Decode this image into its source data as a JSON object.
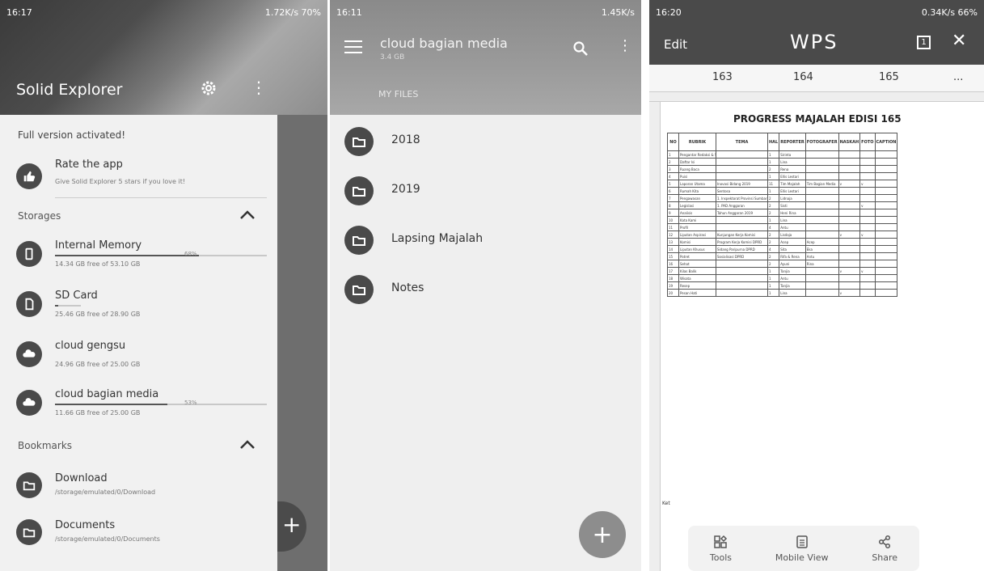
{
  "panel1": {
    "status": {
      "time": "16:17",
      "right": "1.72K/s 70%"
    },
    "app_title": "Solid Explorer",
    "drawer": {
      "full_version": "Full version activated!",
      "rate": {
        "title": "Rate the app",
        "subtitle": "Give Solid Explorer 5 stars if you love it!"
      },
      "storages_label": "Storages",
      "storages": [
        {
          "name": "Internal Memory",
          "detail": "14.34 GB free of 53.10 GB",
          "pct": "68%",
          "fill": 0.68
        },
        {
          "name": "SD Card",
          "detail": "25.46 GB free of 28.90 GB",
          "pct": "",
          "fill": 0.12
        },
        {
          "name": "cloud gengsu",
          "detail": "24.96 GB free of 25.00 GB",
          "pct": "",
          "fill": 0.01
        },
        {
          "name": "cloud bagian media",
          "detail": "11.66 GB free of 25.00 GB",
          "pct": "53%",
          "fill": 0.53
        }
      ],
      "bookmarks_label": "Bookmarks",
      "bookmarks": [
        {
          "name": "Download",
          "path": "/storage/emulated/0/Download"
        },
        {
          "name": "Documents",
          "path": "/storage/emulated/0/Documents"
        }
      ]
    }
  },
  "panel2": {
    "status": {
      "time": "16:11",
      "right": "1.45K/s"
    },
    "title": "cloud bagian media",
    "subtitle": "3.4 GB",
    "tab": "MY FILES",
    "items": [
      "2018",
      "2019",
      "Lapsing Majalah",
      "Notes"
    ],
    "fab": "+"
  },
  "panel3": {
    "status": {
      "time": "16:20",
      "right": "0.34K/s 66%"
    },
    "edit_label": "Edit",
    "logo": "WPS",
    "page_icon": "1",
    "tabs": [
      "163",
      "164",
      "165",
      "..."
    ],
    "doc_title": "PROGRESS MAJALAH EDISI 165",
    "table_headers": [
      "NO",
      "RUBRIK",
      "TEMA",
      "HAL",
      "REPORTER",
      "FOTOGRAFER",
      "NASKAH",
      "FOTO",
      "CAPTION"
    ],
    "table_rows": [
      [
        "1",
        "Pengantar Redaksi & Susunan Redaksi",
        "",
        "1",
        "Sirinta",
        "",
        "",
        "",
        ""
      ],
      [
        "2",
        "Daftar Isi",
        "",
        "1",
        "Lina",
        "",
        "",
        "",
        ""
      ],
      [
        "3",
        "Ruang Baca",
        "",
        "2",
        "Rena",
        "",
        "",
        "",
        ""
      ],
      [
        "4",
        "Puisi",
        "",
        "1",
        "Ellis Lestari",
        "",
        "",
        "",
        ""
      ],
      [
        "5",
        "Laporan Utama",
        "Inovasi Bidang 2019",
        "11",
        "Tim Majalah",
        "Tim Bagian Media",
        "v",
        "v",
        ""
      ],
      [
        "6",
        "Rumah Kita",
        "Sentosa",
        "1",
        "Ellis Lestari",
        "",
        "",
        "",
        ""
      ],
      [
        "7",
        "Pengawasan",
        "1. Inspektorat Provinsi Sumbar",
        "2",
        "Lidnaja",
        "",
        "",
        "",
        ""
      ],
      [
        "8",
        "Legislasi",
        "1. PAD Anggaran",
        "2",
        "Sisti",
        "",
        "",
        "v",
        ""
      ],
      [
        "9",
        "Analisis",
        "Tahun Anggaran 2019",
        "2",
        "Heni Rina",
        "",
        "",
        "",
        ""
      ],
      [
        "10",
        "Kata Kami",
        "",
        "1",
        "Lina",
        "",
        "",
        "",
        ""
      ],
      [
        "11",
        "Profil",
        "",
        "4",
        "Antu",
        "",
        "",
        "",
        ""
      ],
      [
        "12",
        "Liputan Aspirasi",
        "Kunjungan Kerja Komisi",
        "2",
        "Lisdaja",
        "",
        "v",
        "v",
        ""
      ],
      [
        "13",
        "Komisi",
        "Program Kerja Komisi DPRD",
        "2",
        "Acep",
        "Acep",
        "",
        "",
        ""
      ],
      [
        "14",
        "Liputan Khusus",
        "Sidang Paripurna DPRD",
        "4",
        "Sita",
        "Eka",
        "",
        "",
        ""
      ],
      [
        "15",
        "Potret",
        "Sosialisasi DPRD",
        "2",
        "Rifa & Rena",
        "Antu",
        "",
        "",
        ""
      ],
      [
        "16",
        "Sehat",
        "",
        "2",
        "Ayuni",
        "Rina",
        "",
        "",
        ""
      ],
      [
        "17",
        "Kilas Balik",
        "",
        "1",
        "Tanjia",
        "",
        "v",
        "v",
        ""
      ],
      [
        "18",
        "Wisata",
        "",
        "1",
        "Antu",
        "",
        "",
        "",
        ""
      ],
      [
        "19",
        "Resep",
        "",
        "1",
        "Tanjia",
        "",
        "",
        "",
        ""
      ],
      [
        "20",
        "Pesan Hati",
        "",
        "1",
        "Lina",
        "",
        "v",
        "",
        ""
      ]
    ],
    "ket_label": "Ket",
    "toolbar": [
      {
        "label": "Tools",
        "icon": "tools-icon"
      },
      {
        "label": "Mobile View",
        "icon": "mobile-view-icon"
      },
      {
        "label": "Share",
        "icon": "share-icon"
      }
    ]
  }
}
